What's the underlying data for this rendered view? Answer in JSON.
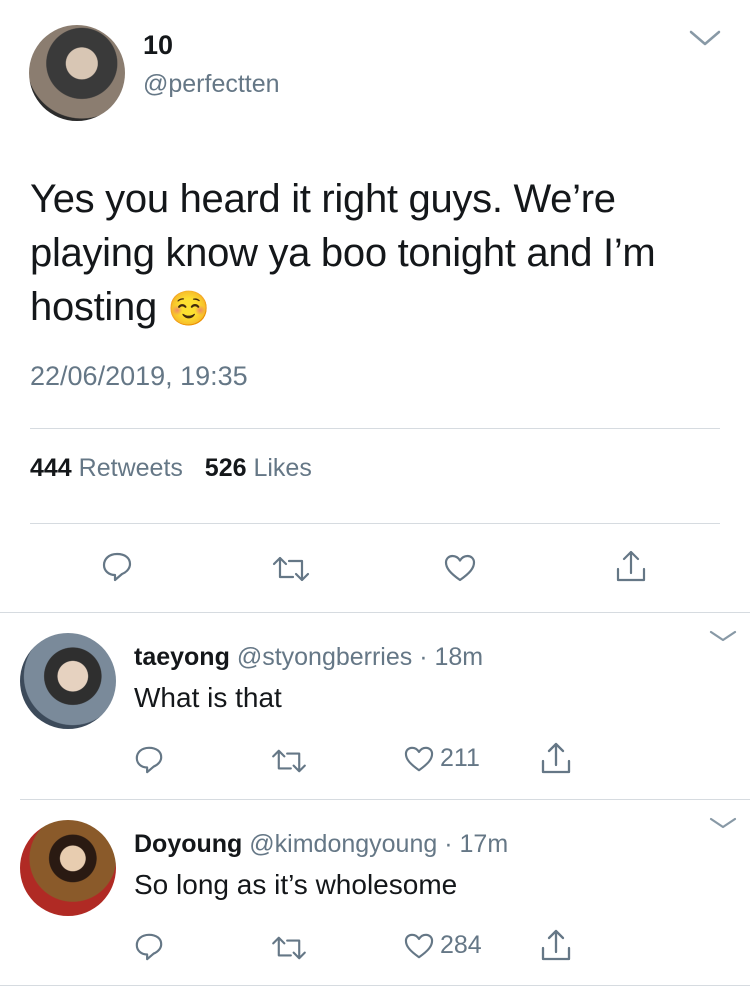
{
  "tweet": {
    "display_name": "10",
    "handle": "@perfectten",
    "text": "Yes you heard it right guys. We’re playing know ya boo tonight and I’m hosting",
    "emoji": "☺️",
    "timestamp": "22/06/2019, 19:35",
    "retweet_count": "444",
    "retweet_label": "Retweets",
    "like_count": "526",
    "like_label": "Likes"
  },
  "replies": [
    {
      "display_name": "taeyong",
      "handle": "@styongberries",
      "separator": "·",
      "age": "18m",
      "text": "What is that",
      "likes": "211"
    },
    {
      "display_name": "Doyoung",
      "handle": "@kimdongyoung",
      "separator": "·",
      "age": "17m",
      "text": "So long as it’s wholesome",
      "likes": "284"
    }
  ],
  "colors": {
    "text": "#14171a",
    "secondary": "#657786",
    "divider": "#d6dbe0"
  },
  "icons": [
    "chevron-down-icon",
    "reply-icon",
    "retweet-icon",
    "like-icon",
    "share-icon"
  ]
}
